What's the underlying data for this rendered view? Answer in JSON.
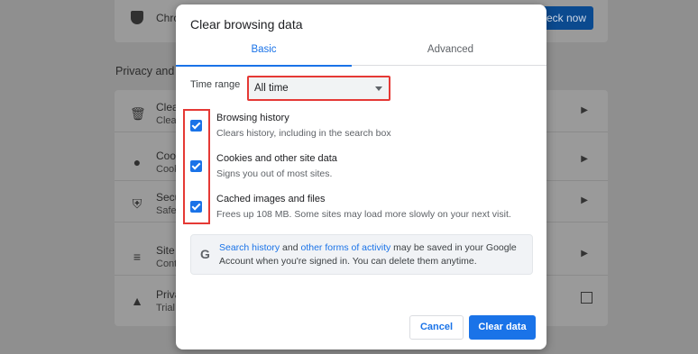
{
  "background": {
    "top_card_text": "Chro",
    "check_now_label": "eck now",
    "section_heading": "Privacy and s",
    "rows": [
      {
        "title": "Clear",
        "sub": "Clea",
        "icon": "trash-icon"
      },
      {
        "title": "Cook",
        "sub": "Cook",
        "icon": "cookie-icon"
      },
      {
        "title": "Secu",
        "sub": "Safe",
        "icon": "shield-icon"
      },
      {
        "title": "Site s",
        "sub": "Cont",
        "icon": "sliders-icon"
      },
      {
        "title": "Priva",
        "sub": "Trial",
        "icon": "flask-icon"
      }
    ]
  },
  "dialog": {
    "title": "Clear browsing data",
    "tabs": [
      {
        "label": "Basic",
        "active": true
      },
      {
        "label": "Advanced",
        "active": false
      }
    ],
    "time_range": {
      "label": "Time range",
      "value": "All time"
    },
    "options": [
      {
        "title": "Browsing history",
        "subtitle": "Clears history, including in the search box",
        "checked": true
      },
      {
        "title": "Cookies and other site data",
        "subtitle": "Signs you out of most sites.",
        "checked": true
      },
      {
        "title": "Cached images and files",
        "subtitle": "Frees up 108 MB. Some sites may load more slowly on your next visit.",
        "checked": true
      }
    ],
    "info": {
      "icon": "G",
      "link1": "Search history",
      "text1": " and ",
      "link2": "other forms of activity",
      "text2": " may be saved in your Google Account when you're signed in. You can delete them anytime."
    },
    "buttons": {
      "cancel": "Cancel",
      "clear": "Clear data"
    }
  },
  "colors": {
    "accent": "#1a73e8",
    "highlight": "#e53935"
  }
}
